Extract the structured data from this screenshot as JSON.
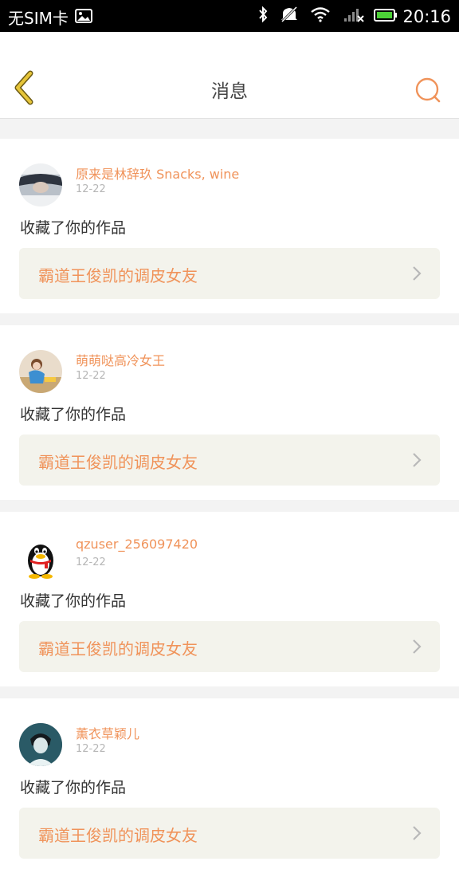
{
  "status_bar": {
    "carrier": "无SIM卡",
    "time": "20:16"
  },
  "header": {
    "title": "消息"
  },
  "messages": [
    {
      "username": "原来是林辞玖 Snacks, wine",
      "time": "12-22",
      "action": "收藏了你的作品",
      "work_title": "霸道王俊凯的调皮女友"
    },
    {
      "username": "萌萌哒高冷女王",
      "time": "12-22",
      "action": "收藏了你的作品",
      "work_title": "霸道王俊凯的调皮女友"
    },
    {
      "username": "qzuser_256097420",
      "time": "12-22",
      "action": "收藏了你的作品",
      "work_title": "霸道王俊凯的调皮女友"
    },
    {
      "username": "薰衣草颖儿",
      "time": "12-22",
      "action": "收藏了你的作品",
      "work_title": "霸道王俊凯的调皮女友"
    }
  ],
  "colors": {
    "accent": "#f0935a",
    "back_icon": "#c9a51f"
  }
}
